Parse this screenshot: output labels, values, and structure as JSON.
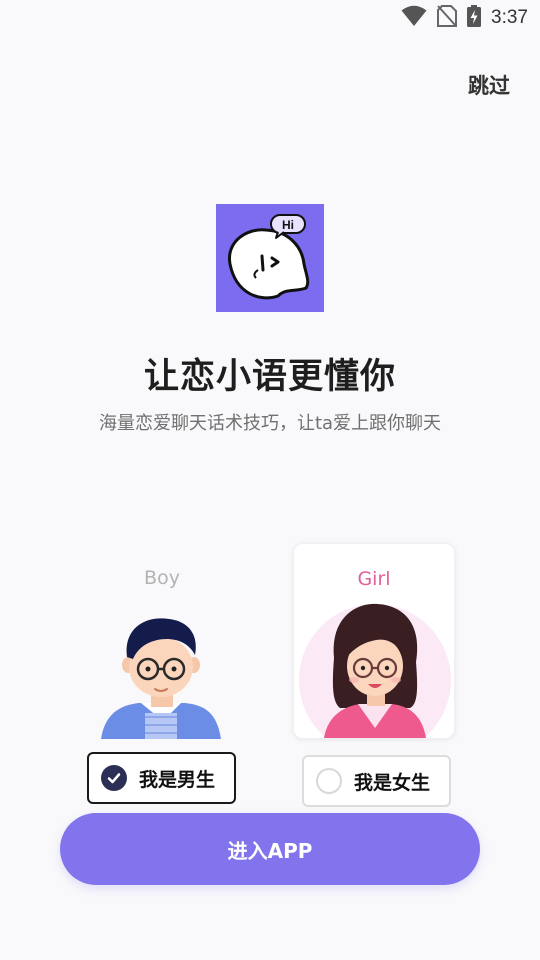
{
  "status_bar": {
    "time": "3:37"
  },
  "header": {
    "skip_label": "跳过"
  },
  "logo": {
    "bubble_text": "Hi"
  },
  "intro": {
    "title": "让恋小语更懂你",
    "subtitle": "海量恋爱聊天话术技巧，让ta爱上跟你聊天"
  },
  "gender": {
    "boy": {
      "card_label": "Boy",
      "option_label": "我是男生",
      "selected": true
    },
    "girl": {
      "card_label": "Girl",
      "option_label": "我是女生",
      "selected": false
    }
  },
  "cta": {
    "label": "进入APP"
  },
  "colors": {
    "accent": "#8274ec",
    "logo_bg": "#7b6cf0",
    "check_fill": "#2b2f55",
    "girl_label": "#e0609a"
  },
  "icons": [
    "wifi-icon",
    "no-sim-icon",
    "battery-charging-icon"
  ]
}
